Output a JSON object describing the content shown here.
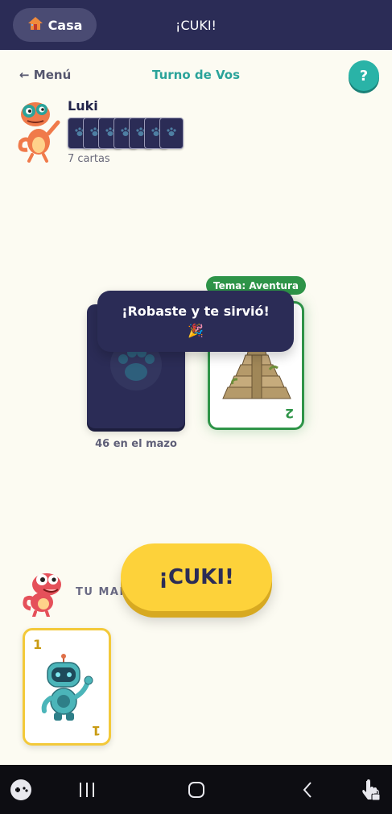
{
  "header": {
    "home_label": "Casa",
    "title": "¡CUKI!"
  },
  "subheader": {
    "back_label": "← Menú",
    "turn_label": "Turno de Vos",
    "help_label": "?"
  },
  "opponent": {
    "name": "Luki",
    "card_count_label": "7 cartas",
    "cards_shown": 7
  },
  "deck": {
    "count_label": "46 en el mazo"
  },
  "discard": {
    "theme_label": "Tema: Aventura",
    "card_number": "2"
  },
  "toast": {
    "message": "¡Robaste y te sirvió!",
    "emoji": "🎉"
  },
  "player": {
    "hand_label": "TU MANO",
    "cuki_button_label": "¡CUKI!",
    "cards": [
      {
        "number": "1",
        "image": "robot"
      }
    ]
  },
  "colors": {
    "header_bg": "#2b2c56",
    "accent_teal": "#2ab3a7",
    "theme_green": "#2e9448",
    "cuki_yellow": "#fdd23a",
    "background": "#fcfbf2"
  },
  "icons": {
    "home": "house-icon",
    "nav_game": "gamepad-icon",
    "nav_recents": "recents-icon",
    "nav_home": "home-circle-icon",
    "nav_back": "back-chevron-icon",
    "nav_touch": "touch-lock-icon"
  }
}
